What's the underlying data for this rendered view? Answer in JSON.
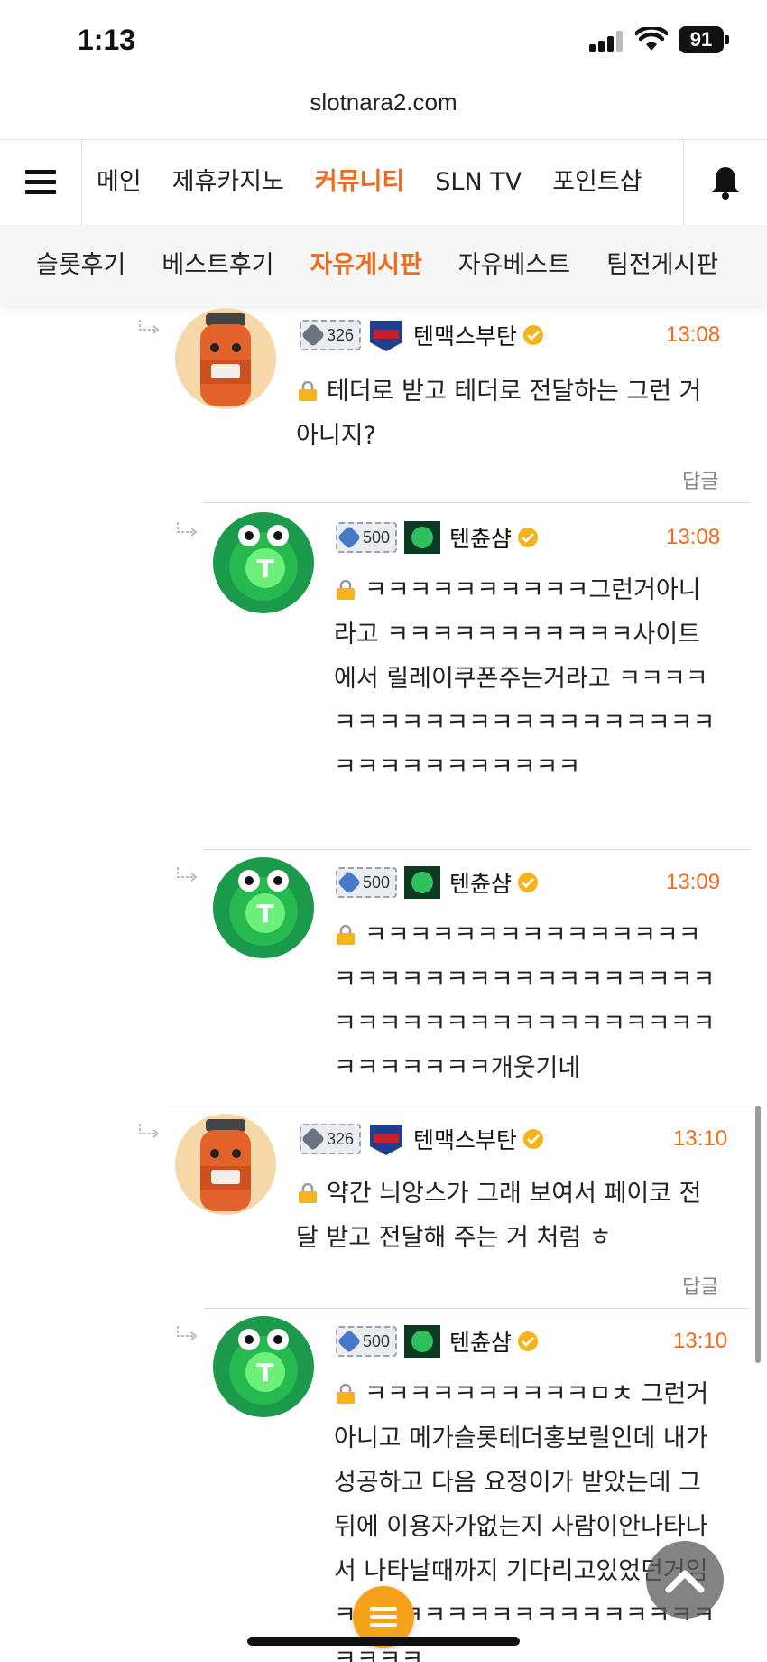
{
  "status_bar": {
    "time": "1:13",
    "battery": "91"
  },
  "browser": {
    "url": "slotnara2.com"
  },
  "nav": {
    "tabs": [
      {
        "label": "메인",
        "active": false
      },
      {
        "label": "제휴카지노",
        "active": false
      },
      {
        "label": "커뮤니티",
        "active": true
      },
      {
        "label": "SLN TV",
        "active": false
      },
      {
        "label": "포인트샵",
        "active": false
      }
    ]
  },
  "subnav": {
    "tabs": [
      {
        "label": "슬롯후기",
        "active": false
      },
      {
        "label": "베스트후기",
        "active": false
      },
      {
        "label": "자유게시판",
        "active": true
      },
      {
        "label": "자유베스트",
        "active": false
      },
      {
        "label": "팀전게시판",
        "active": false
      }
    ]
  },
  "comments": [
    {
      "level": "326",
      "nickname": "텐맥스부탄",
      "time": "13:08",
      "text": "테더로 받고 테더로 전달하는 그런 거 아니지?",
      "reply_label": "답글"
    },
    {
      "level": "500",
      "nickname": "텐츈샴",
      "time": "13:08",
      "text": "ㅋㅋㅋㅋㅋㅋㅋㅋㅋㅋ그런거아니라고 ㅋㅋㅋㅋㅋㅋㅋㅋㅋㅋㅋ사이트에서 릴레이쿠폰주는거라고 ㅋㅋㅋㅋㅋㅋㅋㅋㅋㅋㅋㅋㅋㅋㅋㅋㅋㅋㅋㅋㅋㅋㅋㅋㅋㅋㅋㅋㅋㅋㅋㅋ"
    },
    {
      "level": "500",
      "nickname": "텐츈샴",
      "time": "13:09",
      "text": "ㅋㅋㅋㅋㅋㅋㅋㅋㅋㅋㅋㅋㅋㅋㅋㅋㅋㅋㅋㅋㅋㅋㅋㅋㅋㅋㅋㅋㅋㅋㅋㅋㅋㅋㅋㅋㅋㅋㅋㅋㅋㅋㅋㅋㅋㅋㅋㅋㅋㅋㅋㅋㅋㅋㅋㅋ개웃기네"
    },
    {
      "level": "326",
      "nickname": "텐맥스부탄",
      "time": "13:10",
      "text": "약간 늬앙스가 그래 보여서 페이코 전달 받고 전달해 주는 거 처럼 ㅎ",
      "reply_label": "답글"
    },
    {
      "level": "500",
      "nickname": "텐츈샴",
      "time": "13:10",
      "text": "ㅋㅋㅋㅋㅋㅋㅋㅋㅋㅋㅁㅊ 그런거아니고 메가슬롯테더홍보릴인데 내가 성공하고 다음 요정이가 받았는데 그뒤에 이용자가없는지 사람이안나타나서 나타날때까지 기다리고있었던거임 ㅋㅋㅋㅋㅋㅋㅋㅋㅋㅋㅋㅋㅋㅋㅋㅋㅋㅋㅋㅋㅋ"
    }
  ],
  "colors": {
    "accent": "#f26a1b",
    "fab": "#f7a21b"
  },
  "icons": [
    "hamburger-icon",
    "bell-icon",
    "lock-icon",
    "verified-icon",
    "reply-arrow-icon",
    "arrow-up-icon",
    "list-icon"
  ]
}
